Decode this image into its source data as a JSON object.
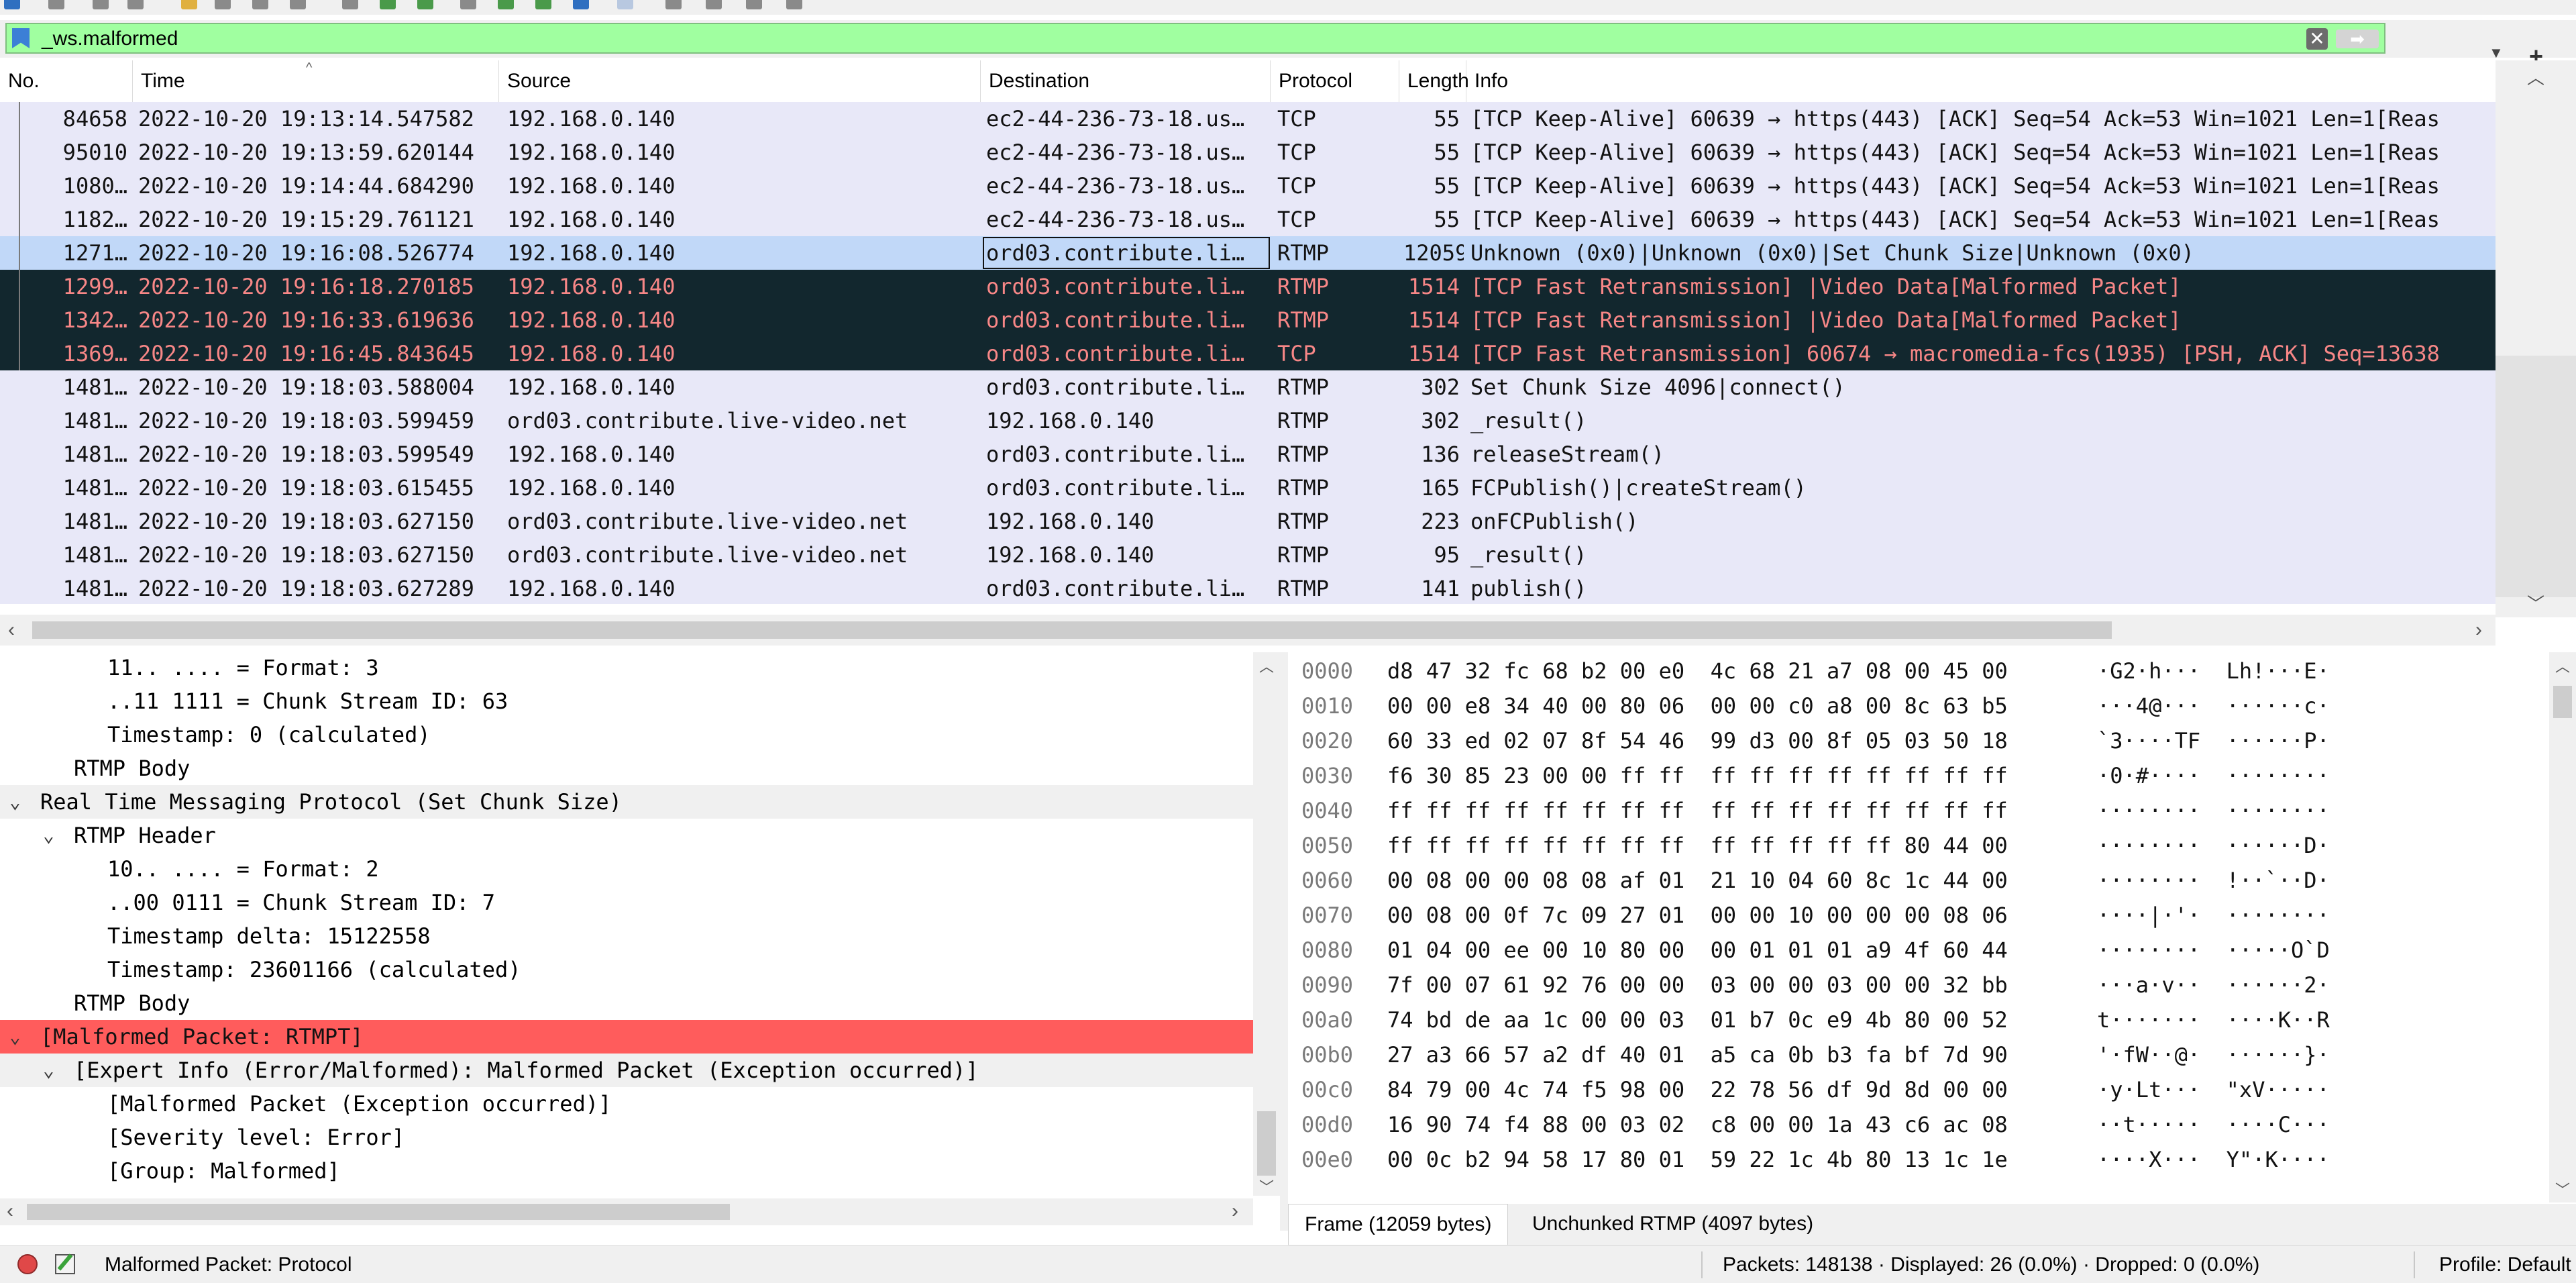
{
  "filter": {
    "value": "_ws.malformed",
    "clear_icon": "clear-icon",
    "apply_icon": "apply-arrow-icon",
    "dropdown_icon": "chevron-down-icon",
    "add_icon": "plus-icon"
  },
  "packet_list": {
    "columns": [
      "No.",
      "Time",
      "Source",
      "Destination",
      "Protocol",
      "Length",
      "Info"
    ],
    "rows": [
      {
        "no": "84658",
        "time": "2022-10-20 19:13:14.547582",
        "source": "192.168.0.140",
        "destination": "ec2-44-236-73-18.us…",
        "protocol": "TCP",
        "length": "55",
        "info": "[TCP Keep-Alive] 60639 → https(443) [ACK] Seq=54 Ack=53 Win=1021 Len=1[Reas",
        "style": "normal"
      },
      {
        "no": "95010",
        "time": "2022-10-20 19:13:59.620144",
        "source": "192.168.0.140",
        "destination": "ec2-44-236-73-18.us…",
        "protocol": "TCP",
        "length": "55",
        "info": "[TCP Keep-Alive] 60639 → https(443) [ACK] Seq=54 Ack=53 Win=1021 Len=1[Reas",
        "style": "normal"
      },
      {
        "no": "1080…",
        "time": "2022-10-20 19:14:44.684290",
        "source": "192.168.0.140",
        "destination": "ec2-44-236-73-18.us…",
        "protocol": "TCP",
        "length": "55",
        "info": "[TCP Keep-Alive] 60639 → https(443) [ACK] Seq=54 Ack=53 Win=1021 Len=1[Reas",
        "style": "normal"
      },
      {
        "no": "1182…",
        "time": "2022-10-20 19:15:29.761121",
        "source": "192.168.0.140",
        "destination": "ec2-44-236-73-18.us…",
        "protocol": "TCP",
        "length": "55",
        "info": "[TCP Keep-Alive] 60639 → https(443) [ACK] Seq=54 Ack=53 Win=1021 Len=1[Reas",
        "style": "normal"
      },
      {
        "no": "1271…",
        "time": "2022-10-20 19:16:08.526774",
        "source": "192.168.0.140",
        "destination": "ord03.contribute.li…",
        "protocol": "RTMP",
        "length": "12059",
        "info": "Unknown (0x0)|Unknown (0x0)|Set Chunk Size|Unknown (0x0)",
        "style": "selected"
      },
      {
        "no": "1299…",
        "time": "2022-10-20 19:16:18.270185",
        "source": "192.168.0.140",
        "destination": "ord03.contribute.li…",
        "protocol": "RTMP",
        "length": "1514",
        "info": "[TCP Fast Retransmission] |Video Data[Malformed Packet]",
        "style": "bad"
      },
      {
        "no": "1342…",
        "time": "2022-10-20 19:16:33.619636",
        "source": "192.168.0.140",
        "destination": "ord03.contribute.li…",
        "protocol": "RTMP",
        "length": "1514",
        "info": "[TCP Fast Retransmission] |Video Data[Malformed Packet]",
        "style": "bad"
      },
      {
        "no": "1369…",
        "time": "2022-10-20 19:16:45.843645",
        "source": "192.168.0.140",
        "destination": "ord03.contribute.li…",
        "protocol": "TCP",
        "length": "1514",
        "info": "[TCP Fast Retransmission] 60674 → macromedia-fcs(1935) [PSH, ACK] Seq=13638",
        "style": "bad"
      },
      {
        "no": "1481…",
        "time": "2022-10-20 19:18:03.588004",
        "source": "192.168.0.140",
        "destination": "ord03.contribute.li…",
        "protocol": "RTMP",
        "length": "302",
        "info": "Set Chunk Size 4096|connect()",
        "style": "normal"
      },
      {
        "no": "1481…",
        "time": "2022-10-20 19:18:03.599459",
        "source": "ord03.contribute.live-video.net",
        "destination": "192.168.0.140",
        "protocol": "RTMP",
        "length": "302",
        "info": "_result()",
        "style": "normal"
      },
      {
        "no": "1481…",
        "time": "2022-10-20 19:18:03.599549",
        "source": "192.168.0.140",
        "destination": "ord03.contribute.li…",
        "protocol": "RTMP",
        "length": "136",
        "info": "releaseStream()",
        "style": "normal"
      },
      {
        "no": "1481…",
        "time": "2022-10-20 19:18:03.615455",
        "source": "192.168.0.140",
        "destination": "ord03.contribute.li…",
        "protocol": "RTMP",
        "length": "165",
        "info": "FCPublish()|createStream()",
        "style": "normal"
      },
      {
        "no": "1481…",
        "time": "2022-10-20 19:18:03.627150",
        "source": "ord03.contribute.live-video.net",
        "destination": "192.168.0.140",
        "protocol": "RTMP",
        "length": "223",
        "info": "onFCPublish()",
        "style": "normal"
      },
      {
        "no": "1481…",
        "time": "2022-10-20 19:18:03.627150",
        "source": "ord03.contribute.live-video.net",
        "destination": "192.168.0.140",
        "protocol": "RTMP",
        "length": "95",
        "info": "_result()",
        "style": "normal"
      },
      {
        "no": "1481…",
        "time": "2022-10-20 19:18:03.627289",
        "source": "192.168.0.140",
        "destination": "ord03.contribute.li…",
        "protocol": "RTMP",
        "length": "141",
        "info": "publish()",
        "style": "normal"
      }
    ]
  },
  "details": {
    "lines": [
      {
        "text": "11.. .... = Format: 3",
        "indent": 3,
        "expander": "",
        "style": "normal"
      },
      {
        "text": "..11 1111 = Chunk Stream ID: 63",
        "indent": 3,
        "expander": "",
        "style": "normal"
      },
      {
        "text": "Timestamp: 0 (calculated)",
        "indent": 3,
        "expander": "",
        "style": "normal"
      },
      {
        "text": "RTMP Body",
        "indent": 2,
        "expander": "",
        "style": "normal"
      },
      {
        "text": "Real Time Messaging Protocol (Set Chunk Size)",
        "indent": 1,
        "expander": "v",
        "style": "hilite"
      },
      {
        "text": "RTMP Header",
        "indent": 2,
        "expander": "v",
        "style": "normal"
      },
      {
        "text": "10.. .... = Format: 2",
        "indent": 3,
        "expander": "",
        "style": "normal"
      },
      {
        "text": "..00 0111 = Chunk Stream ID: 7",
        "indent": 3,
        "expander": "",
        "style": "normal"
      },
      {
        "text": "Timestamp delta: 15122558",
        "indent": 3,
        "expander": "",
        "style": "normal"
      },
      {
        "text": "Timestamp: 23601166 (calculated)",
        "indent": 3,
        "expander": "",
        "style": "normal"
      },
      {
        "text": "RTMP Body",
        "indent": 2,
        "expander": "",
        "style": "normal"
      },
      {
        "text": "[Malformed Packet: RTMPT]",
        "indent": 1,
        "expander": "v",
        "style": "bad"
      },
      {
        "text": "[Expert Info (Error/Malformed): Malformed Packet (Exception occurred)]",
        "indent": 2,
        "expander": "v",
        "style": "hilite"
      },
      {
        "text": "[Malformed Packet (Exception occurred)]",
        "indent": 3,
        "expander": "",
        "style": "normal"
      },
      {
        "text": "[Severity level: Error]",
        "indent": 3,
        "expander": "",
        "style": "normal"
      },
      {
        "text": "[Group: Malformed]",
        "indent": 3,
        "expander": "",
        "style": "normal"
      }
    ]
  },
  "bytes": {
    "rows": [
      {
        "offset": "0000",
        "hex": "d8 47 32 fc 68 b2 00 e0  4c 68 21 a7 08 00 45 00",
        "ascii": "·G2·h···  Lh!···E·"
      },
      {
        "offset": "0010",
        "hex": "00 00 e8 34 40 00 80 06  00 00 c0 a8 00 8c 63 b5",
        "ascii": "···4@···  ······c·"
      },
      {
        "offset": "0020",
        "hex": "60 33 ed 02 07 8f 54 46  99 d3 00 8f 05 03 50 18",
        "ascii": "`3····TF  ······P·"
      },
      {
        "offset": "0030",
        "hex": "f6 30 85 23 00 00 ff ff  ff ff ff ff ff ff ff ff",
        "ascii": "·0·#····  ········"
      },
      {
        "offset": "0040",
        "hex": "ff ff ff ff ff ff ff ff  ff ff ff ff ff ff ff ff",
        "ascii": "········  ········"
      },
      {
        "offset": "0050",
        "hex": "ff ff ff ff ff ff ff ff  ff ff ff ff ff 80 44 00",
        "ascii": "········  ······D·"
      },
      {
        "offset": "0060",
        "hex": "00 08 00 00 08 08 af 01  21 10 04 60 8c 1c 44 00",
        "ascii": "········  !··`··D·"
      },
      {
        "offset": "0070",
        "hex": "00 08 00 0f 7c 09 27 01  00 00 10 00 00 00 08 06",
        "ascii": "····|·'·  ········"
      },
      {
        "offset": "0080",
        "hex": "01 04 00 ee 00 10 80 00  00 01 01 01 a9 4f 60 44",
        "ascii": "········  ·····O`D"
      },
      {
        "offset": "0090",
        "hex": "7f 00 07 61 92 76 00 00  03 00 00 03 00 00 32 bb",
        "ascii": "···a·v··  ······2·"
      },
      {
        "offset": "00a0",
        "hex": "74 bd de aa 1c 00 00 03  01 b7 0c e9 4b 80 00 52",
        "ascii": "t·······  ····K··R"
      },
      {
        "offset": "00b0",
        "hex": "27 a3 66 57 a2 df 40 01  a5 ca 0b b3 fa bf 7d 90",
        "ascii": "'·fW··@·  ······}·"
      },
      {
        "offset": "00c0",
        "hex": "84 79 00 4c 74 f5 98 00  22 78 56 df 9d 8d 00 00",
        "ascii": "·y·Lt···  \"xV·····"
      },
      {
        "offset": "00d0",
        "hex": "16 90 74 f4 88 00 03 02  c8 00 00 1a 43 c6 ac 08",
        "ascii": "··t·····  ····C···"
      },
      {
        "offset": "00e0",
        "hex": "00 0c b2 94 58 17 80 01  59 22 1c 4b 80 13 1c 1e",
        "ascii": "····X···  Y\"·K····"
      }
    ],
    "tabs": [
      "Frame (12059 bytes)",
      "Unchunked RTMP (4097 bytes)"
    ]
  },
  "status": {
    "message": "Malformed Packet: Protocol",
    "led_icon": "expert-info-error-icon",
    "edit_icon": "capture-comment-icon",
    "packets": "Packets: 148138 · Displayed: 26 (0.0%) · Dropped: 0 (0.0%)",
    "profile": "Profile: Default"
  },
  "colors": {
    "filter_valid": "#a0ffa0",
    "row_normal": "#e8e8f8",
    "row_selected": "#c1d8f8",
    "row_bad_bg": "#12272e",
    "row_bad_fg": "#f78787",
    "malformed_bg": "#ff5c5c"
  }
}
